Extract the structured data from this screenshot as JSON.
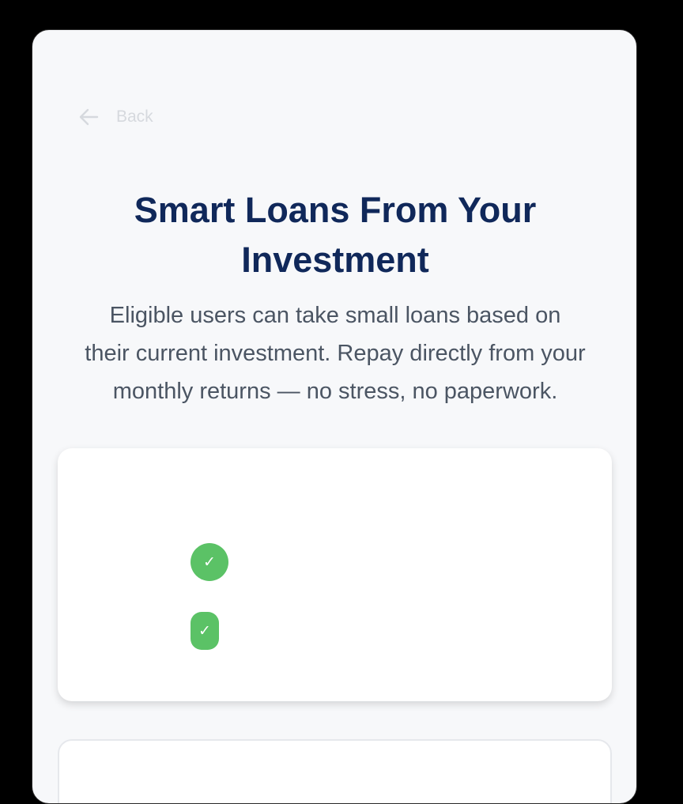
{
  "nav": {
    "back_label": "Back",
    "back_icon": "arrow-left-icon"
  },
  "hero": {
    "title_lines": [
      "Smart Loans From Your",
      "Investment"
    ],
    "subtitle_lines": [
      "Eligible users can take small loans based on",
      "their current investment. Repay directly from your",
      "monthly returns — no stress, no paperwork."
    ]
  },
  "features_card": {
    "items": [
      {
        "icon": "check-icon",
        "mark": "✓"
      },
      {
        "icon": "check-icon",
        "mark": "✓"
      }
    ]
  },
  "colors": {
    "page_background": "#f7f8fa",
    "title": "#10285a",
    "body_text": "#4b5563",
    "check_green": "#5bc266",
    "back_muted": "#d6d9de"
  }
}
